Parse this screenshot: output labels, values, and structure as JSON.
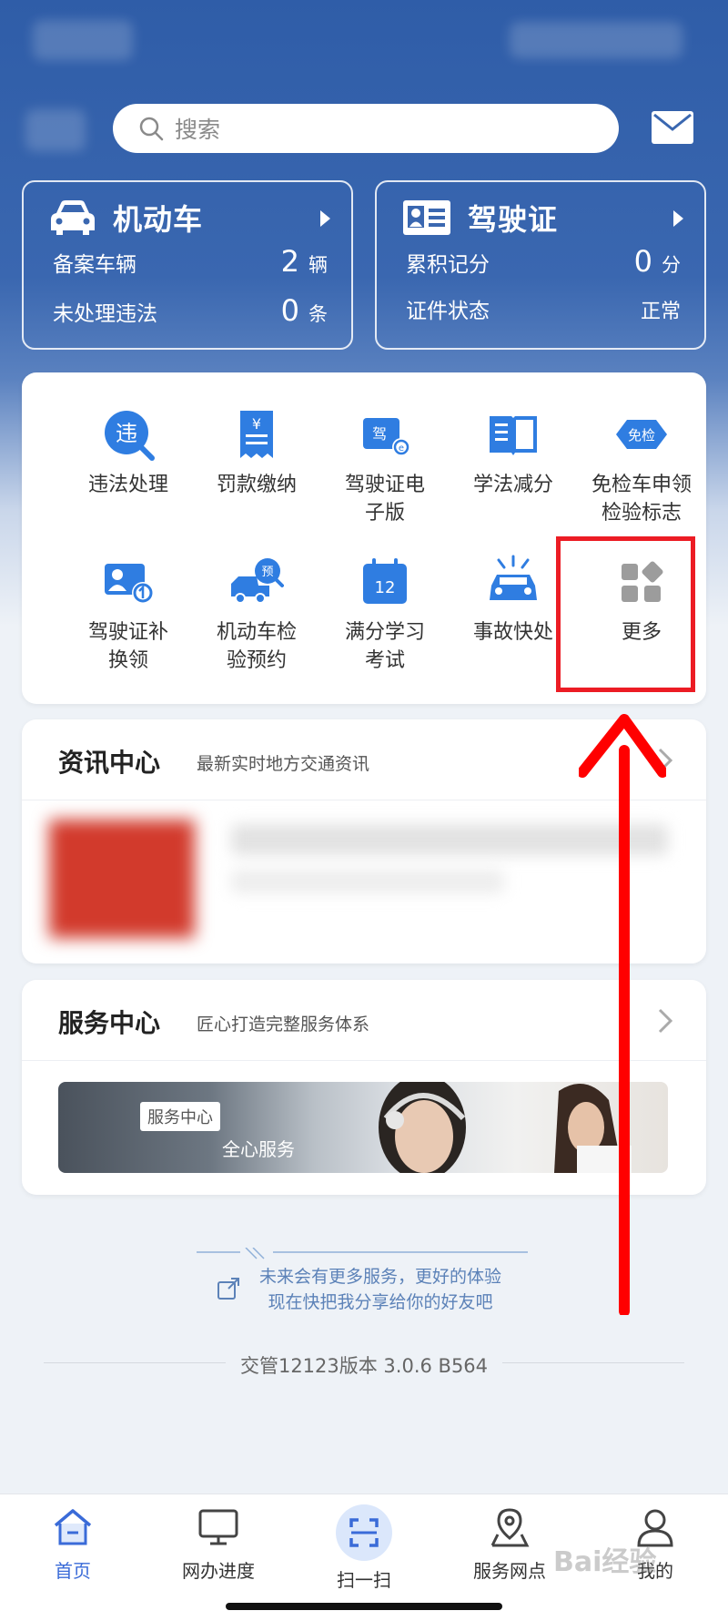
{
  "search": {
    "placeholder": "搜索"
  },
  "vehicle_card": {
    "title": "机动车",
    "rows": [
      {
        "label": "备案车辆",
        "value": "2",
        "unit": "辆"
      },
      {
        "label": "未处理违法",
        "value": "0",
        "unit": "条"
      }
    ]
  },
  "license_card": {
    "title": "驾驶证",
    "rows": [
      {
        "label": "累积记分",
        "value": "0",
        "unit": "分"
      },
      {
        "label": "证件状态",
        "value": "正常",
        "unit": ""
      }
    ]
  },
  "services": [
    {
      "label": "违法处理",
      "icon": "violation-icon"
    },
    {
      "label": "罚款缴纳",
      "icon": "fine-payment-icon"
    },
    {
      "label": "驾驶证电\n子版",
      "icon": "e-license-icon"
    },
    {
      "label": "学法减分",
      "icon": "study-book-icon"
    },
    {
      "label": "免检车申领\n检验标志",
      "icon": "exempt-inspection-icon"
    },
    {
      "label": "驾驶证补\n换领",
      "icon": "license-renew-icon"
    },
    {
      "label": "机动车检\n验预约",
      "icon": "inspection-booking-icon"
    },
    {
      "label": "满分学习\n考试",
      "icon": "calendar-12-icon"
    },
    {
      "label": "事故快处",
      "icon": "accident-icon"
    },
    {
      "label": "更多",
      "icon": "more-grid-icon"
    }
  ],
  "news_center": {
    "title": "资讯中心",
    "subtitle": "最新实时地方交通资讯"
  },
  "service_center": {
    "title": "服务中心",
    "subtitle": "匠心打造完整服务体系",
    "banner_tag": "服务中心",
    "banner_text": "全心服务"
  },
  "share_text": {
    "line1": "未来会有更多服务，更好的体验",
    "line2": "现在快把我分享给你的好友吧"
  },
  "version": "交管12123版本 3.0.6 B564",
  "tabs": [
    {
      "label": "首页",
      "icon": "home-icon",
      "active": true
    },
    {
      "label": "网办进度",
      "icon": "monitor-icon",
      "active": false
    },
    {
      "label": "扫一扫",
      "icon": "scan-icon",
      "active": false
    },
    {
      "label": "服务网点",
      "icon": "map-pin-icon",
      "active": false
    },
    {
      "label": "我的",
      "icon": "user-icon",
      "active": false
    }
  ],
  "watermark": "Bai经验",
  "colors": {
    "brand_blue": "#2f5da8",
    "icon_blue": "#2f7de1",
    "highlight_red": "#ec1c24",
    "arrow_red": "#ff0000"
  }
}
